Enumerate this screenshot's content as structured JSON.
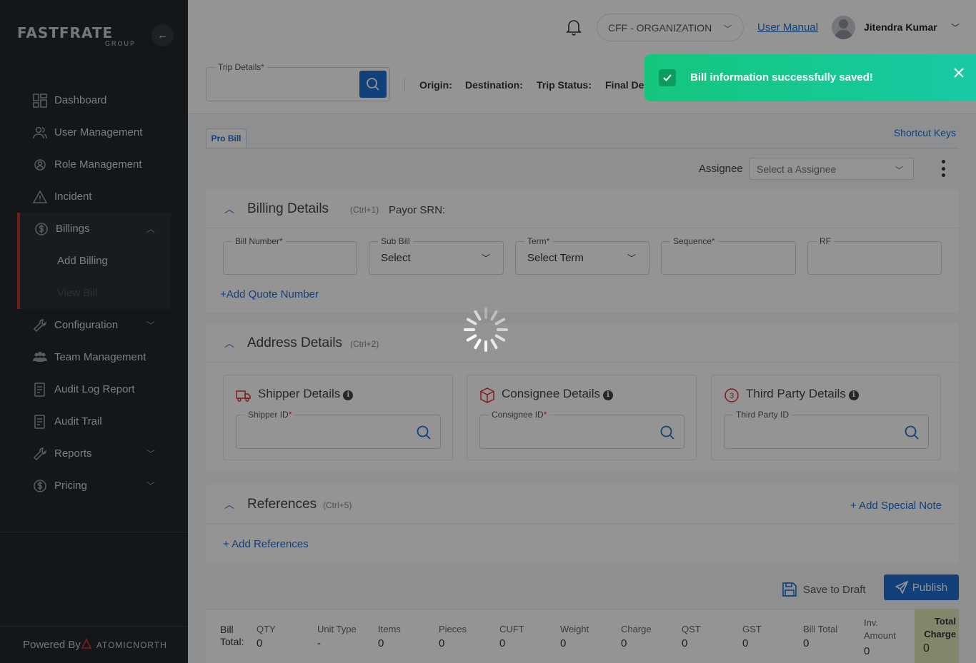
{
  "sidebar": {
    "logo_main": "FASTFRATE",
    "logo_sub": "GROUP",
    "items": [
      {
        "label": "Dashboard",
        "icon": "dashboard-icon"
      },
      {
        "label": "User Management",
        "icon": "users-icon"
      },
      {
        "label": "Role Management",
        "icon": "role-icon"
      },
      {
        "label": "Incident",
        "icon": "warning-icon"
      }
    ],
    "billings": {
      "label": "Billings",
      "sub_items": [
        {
          "label": "Add Billing"
        },
        {
          "label": "View Bill"
        }
      ]
    },
    "items_after": [
      {
        "label": "Configuration",
        "icon": "wrench-icon",
        "has_chevron": true
      },
      {
        "label": "Team Management",
        "icon": "team-icon",
        "has_chevron": false
      },
      {
        "label": "Audit Log Report",
        "icon": "report-icon",
        "has_chevron": false
      },
      {
        "label": "Audit Trail",
        "icon": "report-icon",
        "has_chevron": false
      },
      {
        "label": "Reports",
        "icon": "wrench-icon",
        "has_chevron": true
      },
      {
        "label": "Pricing",
        "icon": "dollar-icon",
        "has_chevron": true
      }
    ],
    "powered_by": "Powered By",
    "powered_brand": "ATOMICNORTH"
  },
  "header": {
    "org": "CFF - ORGANIZATION",
    "user_manual": "User Manual",
    "username": "Jitendra Kumar"
  },
  "trip": {
    "label": "Trip Details",
    "origin": "Origin:",
    "destination": "Destination:",
    "status": "Trip Status:",
    "final": "Final De"
  },
  "tabs": {
    "pro_bill": "Pro Bill",
    "shortcut_keys": "Shortcut Keys"
  },
  "assignee": {
    "label": "Assignee",
    "placeholder": "Select a Assignee"
  },
  "billing": {
    "title": "Billing Details",
    "shortcut": "(Ctrl+1)",
    "payor": "Payor SRN:",
    "bill_number_label": "Bill Number",
    "sub_bill_label": "Sub Bill",
    "sub_bill_value": "Select",
    "term_label": "Term",
    "term_value": "Select Term",
    "sequence_label": "Sequence",
    "rf_label": "RF",
    "add_quote": "+Add Quote Number"
  },
  "address": {
    "title": "Address Details",
    "shortcut": "(Ctrl+2)",
    "shipper_title": "Shipper Details",
    "shipper_id": "Shipper ID",
    "consignee_title": "Consignee Details",
    "consignee_id": "Consignee ID",
    "third_title": "Third Party Details",
    "third_id": "Third Party ID"
  },
  "references": {
    "title": "References",
    "shortcut": "(Ctrl+5)",
    "add_special_note": "+ Add Special Note",
    "add_references": "+ Add References"
  },
  "actions": {
    "save_draft": "Save to Draft",
    "publish": "Publish"
  },
  "totals": {
    "title_line1": "Bill",
    "title_line2": "Total:",
    "columns": [
      {
        "label": "QTY",
        "value": "0"
      },
      {
        "label": "Unit Type",
        "value": "-"
      },
      {
        "label": "Items",
        "value": "0"
      },
      {
        "label": "Pieces",
        "value": "0"
      },
      {
        "label": "CUFT",
        "value": "0"
      },
      {
        "label": "Weight",
        "value": "0"
      },
      {
        "label": "Charge",
        "value": "0"
      },
      {
        "label": "QST",
        "value": "0"
      },
      {
        "label": "GST",
        "value": "0"
      },
      {
        "label": "Bill Total",
        "value": "0"
      }
    ],
    "inv_label_1": "Inv.",
    "inv_label_2": "Amount",
    "inv_value": "0",
    "total_charge_1": "Total",
    "total_charge_2": "Charge",
    "total_charge_value": "0"
  },
  "toast": {
    "message": "Bill information successfully saved!"
  },
  "colors": {
    "accent": "#1f6fd1",
    "sidebar": "#24292e",
    "toast": "#14c67c",
    "billing_marker": "#c0392b"
  }
}
